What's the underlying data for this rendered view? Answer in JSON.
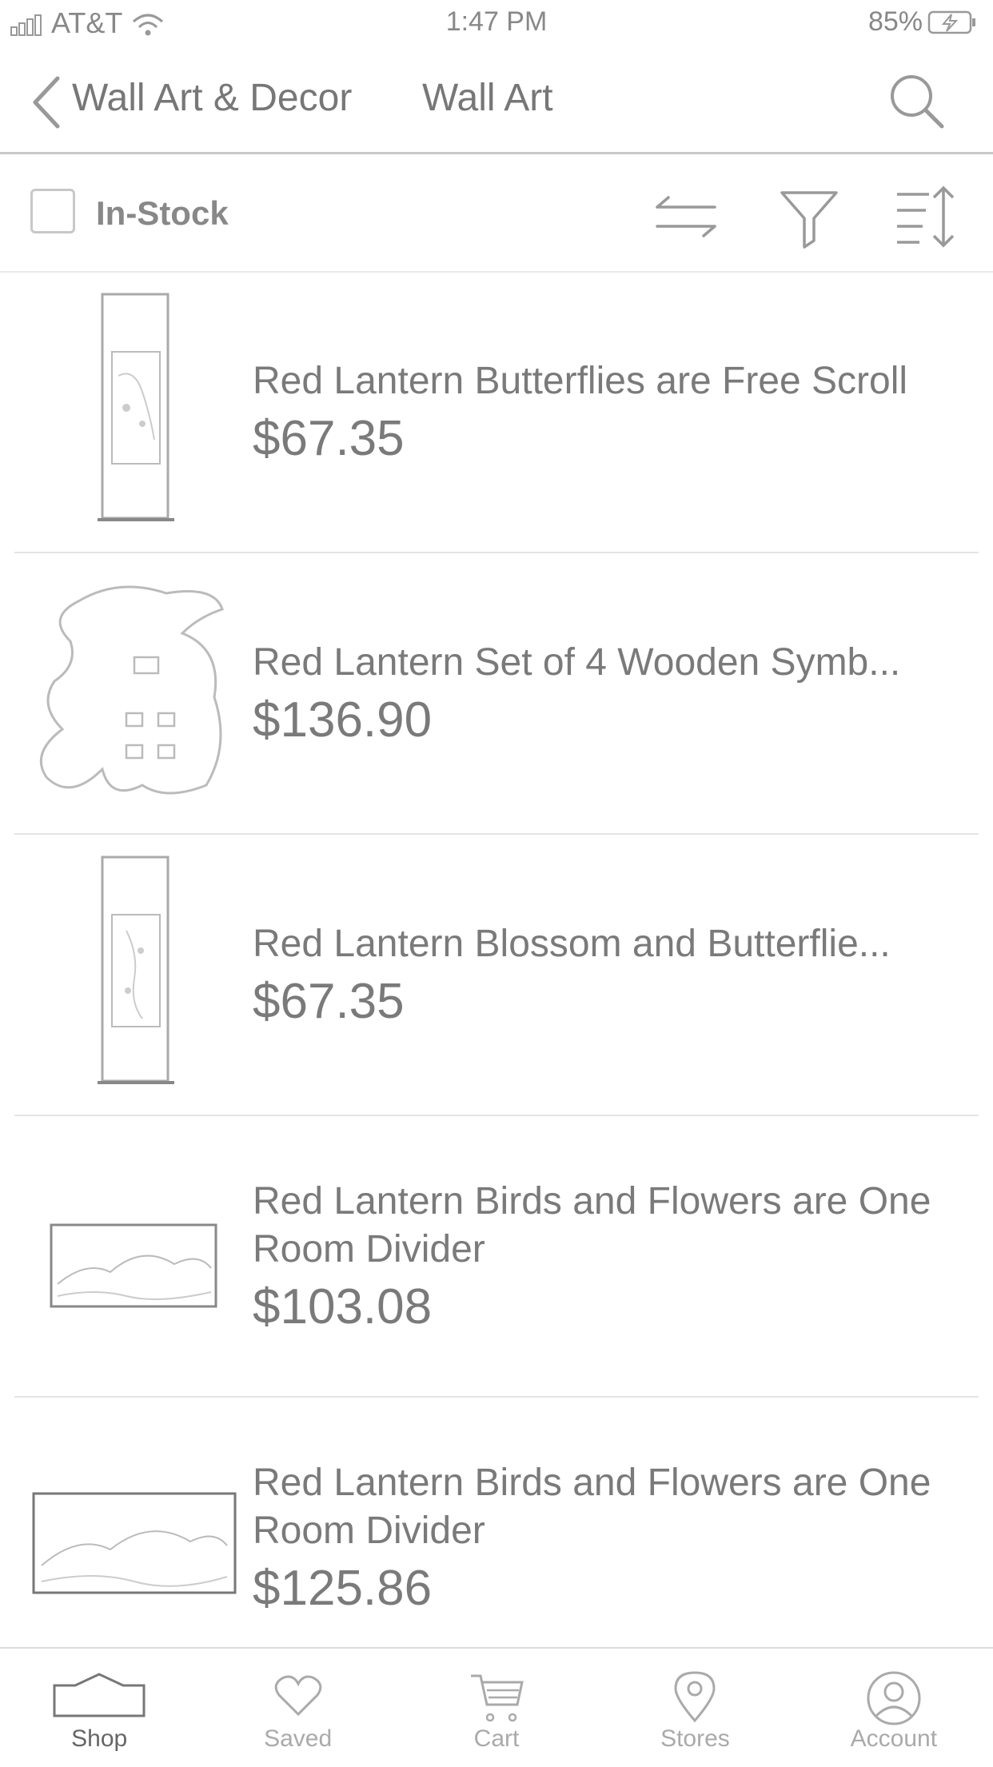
{
  "status": {
    "carrier": "AT&T",
    "time": "1:47 PM",
    "battery": "85%"
  },
  "nav": {
    "crumb_parent": "Wall Art & Decor",
    "crumb_current": "Wall Art"
  },
  "filter": {
    "instock_label": "In-Stock"
  },
  "products": [
    {
      "title": "Red Lantern Butterflies are Free Scroll",
      "price": "$67.35"
    },
    {
      "title": "Red Lantern Set of 4 Wooden Symb...",
      "price": "$136.90"
    },
    {
      "title": "Red Lantern Blossom and Butterflie...",
      "price": "$67.35"
    },
    {
      "title": "Red Lantern Birds and Flowers are One Room Divider",
      "price": "$103.08"
    },
    {
      "title": "Red Lantern Birds and Flowers are One Room Divider",
      "price": "$125.86"
    }
  ],
  "tabs": [
    {
      "label": "Shop",
      "icon": "shop-icon"
    },
    {
      "label": "Saved",
      "icon": "heart-icon"
    },
    {
      "label": "Cart",
      "icon": "cart-icon"
    },
    {
      "label": "Stores",
      "icon": "location-pin-icon"
    },
    {
      "label": "Account",
      "icon": "account-icon"
    }
  ]
}
